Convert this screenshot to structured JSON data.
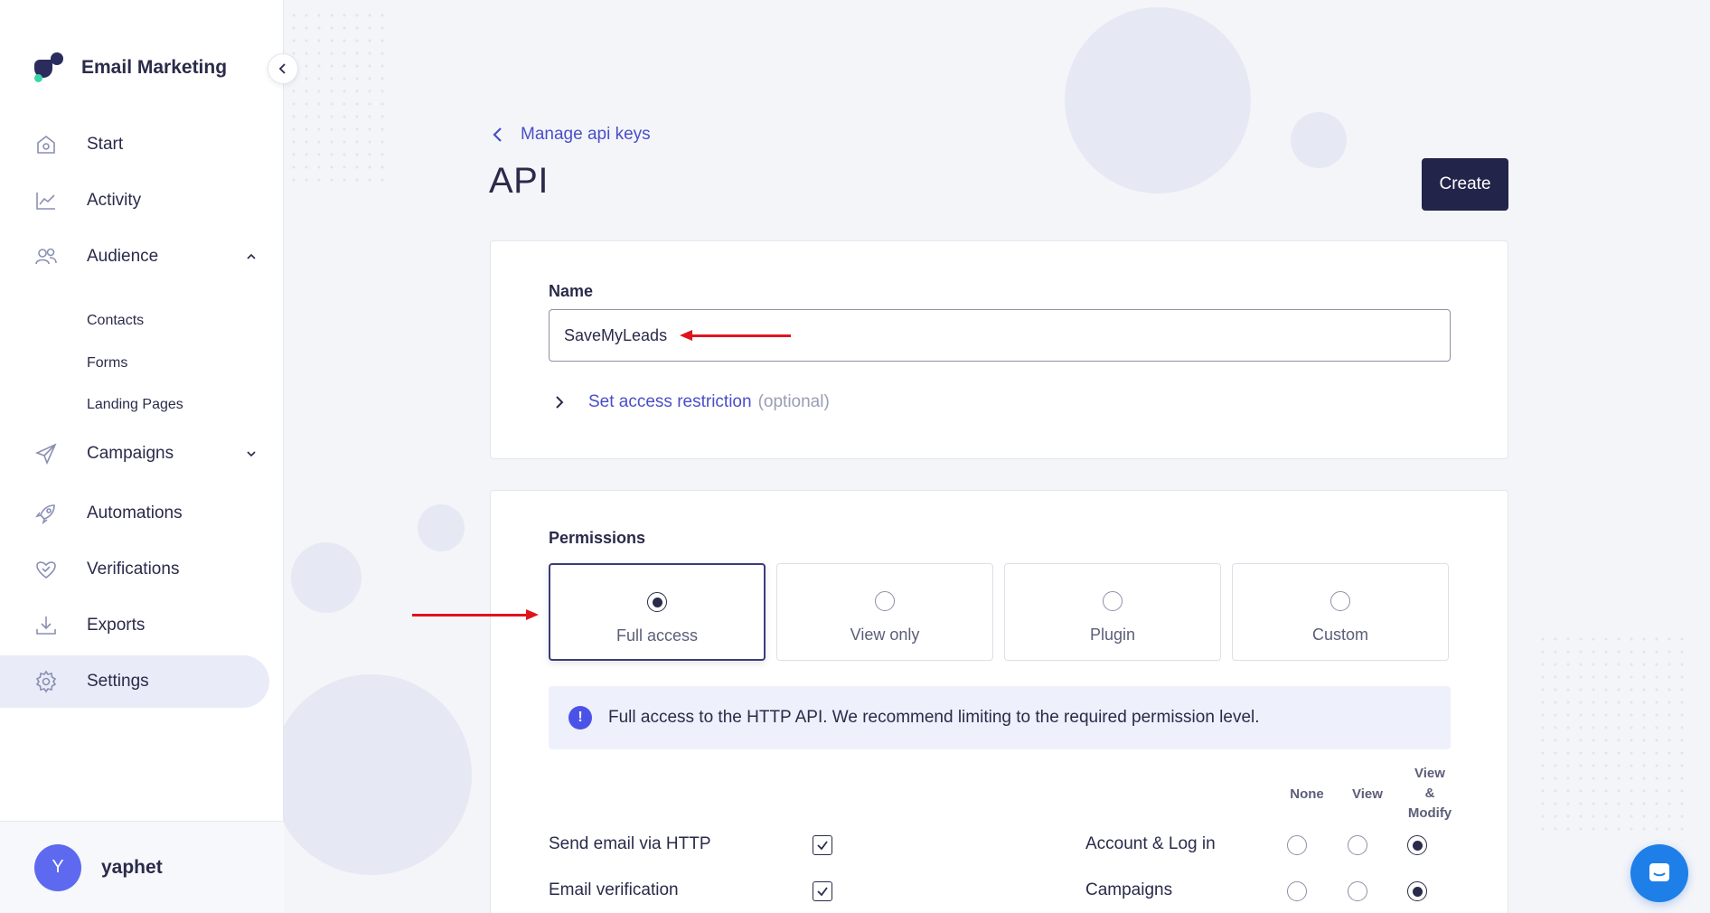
{
  "app": {
    "name": "Email Marketing"
  },
  "sidebar": {
    "items": [
      {
        "label": "Start",
        "icon": "home-icon"
      },
      {
        "label": "Activity",
        "icon": "chart-line-icon"
      },
      {
        "label": "Audience",
        "icon": "users-icon"
      },
      {
        "label": "Campaigns",
        "icon": "paper-plane-icon"
      },
      {
        "label": "Automations",
        "icon": "rocket-icon"
      },
      {
        "label": "Verifications",
        "icon": "heart-check-icon"
      },
      {
        "label": "Exports",
        "icon": "download-icon"
      },
      {
        "label": "Settings",
        "icon": "gear-icon"
      }
    ],
    "audience_sub": [
      "Contacts",
      "Forms",
      "Landing Pages"
    ],
    "active": "Settings"
  },
  "user": {
    "initial": "Y",
    "name": "yaphet"
  },
  "header": {
    "back_label": "Manage api keys",
    "title": "API",
    "create_label": "Create"
  },
  "form": {
    "name_label": "Name",
    "name_value": "SaveMyLeads",
    "restriction_link": "Set access restriction",
    "restriction_optional": "(optional)"
  },
  "permissions": {
    "label": "Permissions",
    "options": [
      "Full access",
      "View only",
      "Plugin",
      "Custom"
    ],
    "selected": "Full access",
    "info": "Full access to the HTTP API. We recommend limiting to the required permission level.",
    "columns": {
      "none": "None",
      "view": "View",
      "view_modify": [
        "View",
        "&",
        "Modify"
      ]
    },
    "left_rows": [
      {
        "label": "Send email via HTTP",
        "checked": true
      },
      {
        "label": "Email verification",
        "checked": true
      }
    ],
    "right_rows": [
      {
        "label": "Account & Log in",
        "level": "View & Modify"
      },
      {
        "label": "Campaigns",
        "level": "View & Modify"
      }
    ]
  },
  "colors": {
    "accent": "#4a4fc8",
    "dark": "#23244a",
    "annotation": "#e0141c",
    "chat": "#1f7fe8"
  }
}
